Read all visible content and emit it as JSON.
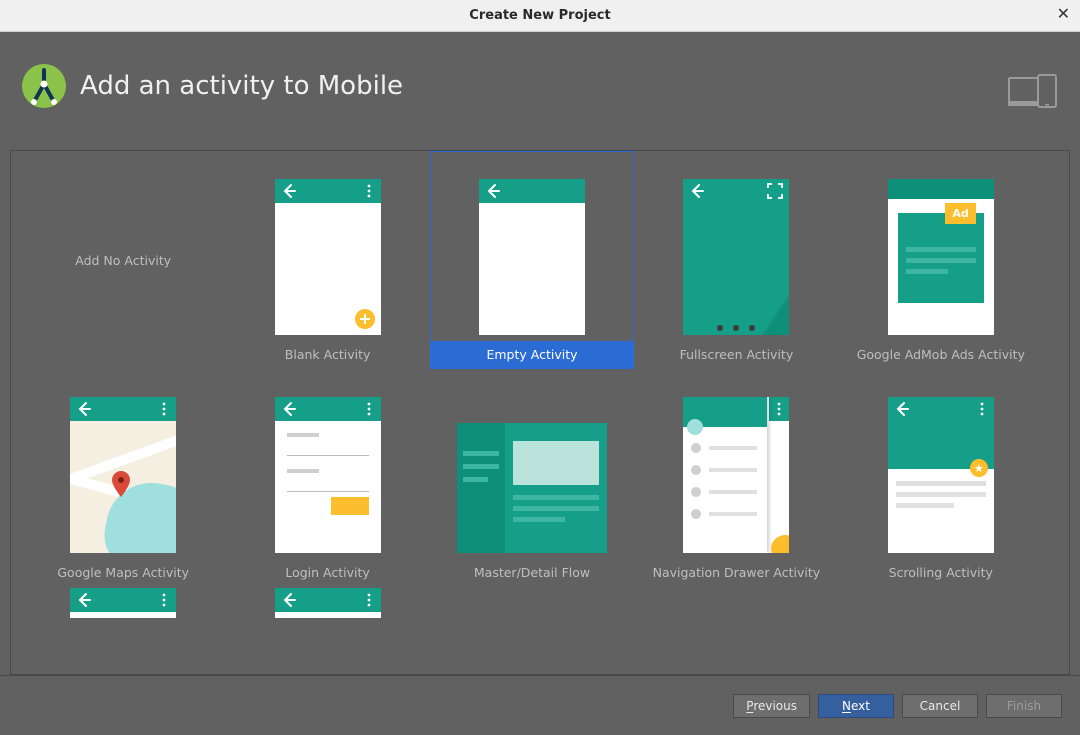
{
  "window": {
    "title": "Create New Project"
  },
  "header": {
    "title": "Add an activity to Mobile"
  },
  "templates": [
    {
      "id": "none",
      "label": "Add No Activity",
      "kind": "none",
      "selected": false
    },
    {
      "id": "blank",
      "label": "Blank Activity",
      "kind": "blank",
      "selected": false
    },
    {
      "id": "empty",
      "label": "Empty Activity",
      "kind": "empty",
      "selected": true
    },
    {
      "id": "fullscreen",
      "label": "Fullscreen Activity",
      "kind": "fullscreen",
      "selected": false
    },
    {
      "id": "admob",
      "label": "Google AdMob Ads Activity",
      "kind": "admob",
      "selected": false
    },
    {
      "id": "maps",
      "label": "Google Maps Activity",
      "kind": "maps",
      "selected": false
    },
    {
      "id": "login",
      "label": "Login Activity",
      "kind": "login",
      "selected": false
    },
    {
      "id": "md",
      "label": "Master/Detail Flow",
      "kind": "md",
      "selected": false
    },
    {
      "id": "nav",
      "label": "Navigation Drawer Activity",
      "kind": "nav",
      "selected": false
    },
    {
      "id": "scroll",
      "label": "Scrolling Activity",
      "kind": "scroll",
      "selected": false
    }
  ],
  "admob": {
    "badge": "Ad"
  },
  "buttons": {
    "previous": "Previous",
    "next": "Next",
    "cancel": "Cancel",
    "finish": "Finish"
  },
  "colors": {
    "headerBg": "#616161",
    "teal": "#159e88",
    "tealDark": "#0d8f79",
    "accentYellow": "#fdbe2d",
    "selectedBlue": "#2a6bd4",
    "primaryBtn": "#365f9e"
  }
}
